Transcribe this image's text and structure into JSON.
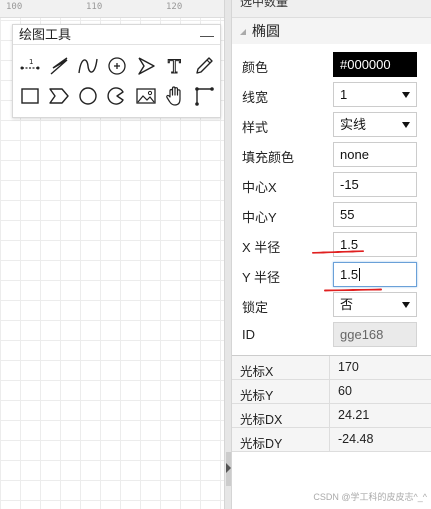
{
  "ruler": {
    "ticks": [
      "100",
      "110",
      "120"
    ]
  },
  "toolbox": {
    "title": "绘图工具",
    "minimize_label": "—",
    "tools": [
      {
        "name": "measure-line-tool",
        "label": "1"
      },
      {
        "name": "polyline-tool"
      },
      {
        "name": "curve-tool"
      },
      {
        "name": "circle-plus-tool"
      },
      {
        "name": "arrow-tool"
      },
      {
        "name": "text-tool",
        "label": "T"
      },
      {
        "name": "pencil-tool"
      },
      {
        "name": "rectangle-tool"
      },
      {
        "name": "chevron-tool"
      },
      {
        "name": "ellipse-tool"
      },
      {
        "name": "arc-tool"
      },
      {
        "name": "image-tool"
      },
      {
        "name": "hand-tool"
      },
      {
        "name": "connector-tool"
      }
    ]
  },
  "panel": {
    "top_label": "选中数量",
    "section_title": "椭圆",
    "rows": [
      {
        "label": "颜色",
        "value": "#000000"
      },
      {
        "label": "线宽",
        "value": "1"
      },
      {
        "label": "样式",
        "value": "实线"
      },
      {
        "label": "填充颜色",
        "value": "none"
      },
      {
        "label": "中心X",
        "value": "-15"
      },
      {
        "label": "中心Y",
        "value": "55"
      },
      {
        "label": "X 半径",
        "value": "1.5"
      },
      {
        "label": "Y 半径",
        "value": "1.5"
      },
      {
        "label": "锁定",
        "value": "否"
      },
      {
        "label": "ID",
        "value": "gge168"
      }
    ]
  },
  "cursor": [
    {
      "key": "光标X",
      "value": "170"
    },
    {
      "key": "光标Y",
      "value": "60"
    },
    {
      "key": "光标DX",
      "value": "24.21"
    },
    {
      "key": "光标DY",
      "value": "-24.48"
    }
  ],
  "watermark": "CSDN @学工科的皮皮志^_^",
  "colors": {
    "selected_color": "#000000",
    "annotation_red": "#e02020"
  }
}
